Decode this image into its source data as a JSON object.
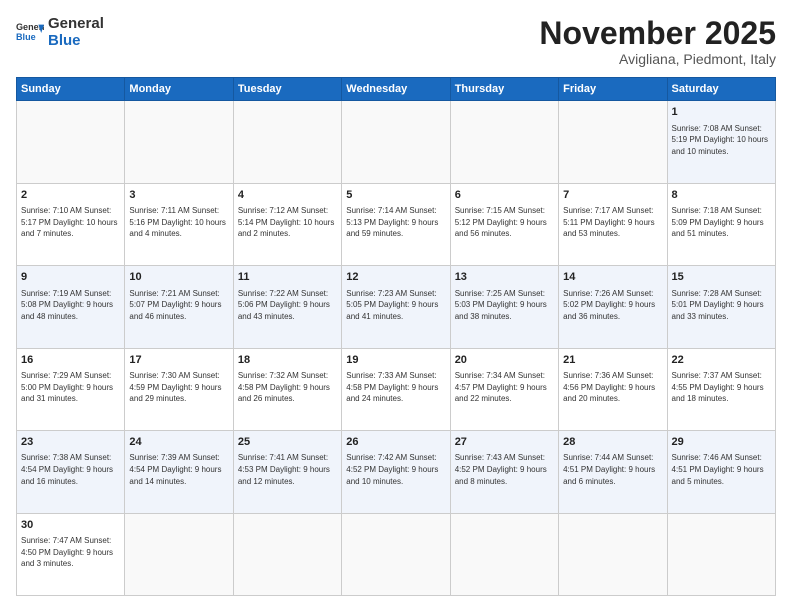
{
  "logo": {
    "text_general": "General",
    "text_blue": "Blue"
  },
  "header": {
    "month_title": "November 2025",
    "subtitle": "Avigliana, Piedmont, Italy"
  },
  "weekdays": [
    "Sunday",
    "Monday",
    "Tuesday",
    "Wednesday",
    "Thursday",
    "Friday",
    "Saturday"
  ],
  "weeks": [
    [
      {
        "day": "",
        "info": ""
      },
      {
        "day": "",
        "info": ""
      },
      {
        "day": "",
        "info": ""
      },
      {
        "day": "",
        "info": ""
      },
      {
        "day": "",
        "info": ""
      },
      {
        "day": "",
        "info": ""
      },
      {
        "day": "1",
        "info": "Sunrise: 7:08 AM\nSunset: 5:19 PM\nDaylight: 10 hours and 10 minutes."
      }
    ],
    [
      {
        "day": "2",
        "info": "Sunrise: 7:10 AM\nSunset: 5:17 PM\nDaylight: 10 hours and 7 minutes."
      },
      {
        "day": "3",
        "info": "Sunrise: 7:11 AM\nSunset: 5:16 PM\nDaylight: 10 hours and 4 minutes."
      },
      {
        "day": "4",
        "info": "Sunrise: 7:12 AM\nSunset: 5:14 PM\nDaylight: 10 hours and 2 minutes."
      },
      {
        "day": "5",
        "info": "Sunrise: 7:14 AM\nSunset: 5:13 PM\nDaylight: 9 hours and 59 minutes."
      },
      {
        "day": "6",
        "info": "Sunrise: 7:15 AM\nSunset: 5:12 PM\nDaylight: 9 hours and 56 minutes."
      },
      {
        "day": "7",
        "info": "Sunrise: 7:17 AM\nSunset: 5:11 PM\nDaylight: 9 hours and 53 minutes."
      },
      {
        "day": "8",
        "info": "Sunrise: 7:18 AM\nSunset: 5:09 PM\nDaylight: 9 hours and 51 minutes."
      }
    ],
    [
      {
        "day": "9",
        "info": "Sunrise: 7:19 AM\nSunset: 5:08 PM\nDaylight: 9 hours and 48 minutes."
      },
      {
        "day": "10",
        "info": "Sunrise: 7:21 AM\nSunset: 5:07 PM\nDaylight: 9 hours and 46 minutes."
      },
      {
        "day": "11",
        "info": "Sunrise: 7:22 AM\nSunset: 5:06 PM\nDaylight: 9 hours and 43 minutes."
      },
      {
        "day": "12",
        "info": "Sunrise: 7:23 AM\nSunset: 5:05 PM\nDaylight: 9 hours and 41 minutes."
      },
      {
        "day": "13",
        "info": "Sunrise: 7:25 AM\nSunset: 5:03 PM\nDaylight: 9 hours and 38 minutes."
      },
      {
        "day": "14",
        "info": "Sunrise: 7:26 AM\nSunset: 5:02 PM\nDaylight: 9 hours and 36 minutes."
      },
      {
        "day": "15",
        "info": "Sunrise: 7:28 AM\nSunset: 5:01 PM\nDaylight: 9 hours and 33 minutes."
      }
    ],
    [
      {
        "day": "16",
        "info": "Sunrise: 7:29 AM\nSunset: 5:00 PM\nDaylight: 9 hours and 31 minutes."
      },
      {
        "day": "17",
        "info": "Sunrise: 7:30 AM\nSunset: 4:59 PM\nDaylight: 9 hours and 29 minutes."
      },
      {
        "day": "18",
        "info": "Sunrise: 7:32 AM\nSunset: 4:58 PM\nDaylight: 9 hours and 26 minutes."
      },
      {
        "day": "19",
        "info": "Sunrise: 7:33 AM\nSunset: 4:58 PM\nDaylight: 9 hours and 24 minutes."
      },
      {
        "day": "20",
        "info": "Sunrise: 7:34 AM\nSunset: 4:57 PM\nDaylight: 9 hours and 22 minutes."
      },
      {
        "day": "21",
        "info": "Sunrise: 7:36 AM\nSunset: 4:56 PM\nDaylight: 9 hours and 20 minutes."
      },
      {
        "day": "22",
        "info": "Sunrise: 7:37 AM\nSunset: 4:55 PM\nDaylight: 9 hours and 18 minutes."
      }
    ],
    [
      {
        "day": "23",
        "info": "Sunrise: 7:38 AM\nSunset: 4:54 PM\nDaylight: 9 hours and 16 minutes."
      },
      {
        "day": "24",
        "info": "Sunrise: 7:39 AM\nSunset: 4:54 PM\nDaylight: 9 hours and 14 minutes."
      },
      {
        "day": "25",
        "info": "Sunrise: 7:41 AM\nSunset: 4:53 PM\nDaylight: 9 hours and 12 minutes."
      },
      {
        "day": "26",
        "info": "Sunrise: 7:42 AM\nSunset: 4:52 PM\nDaylight: 9 hours and 10 minutes."
      },
      {
        "day": "27",
        "info": "Sunrise: 7:43 AM\nSunset: 4:52 PM\nDaylight: 9 hours and 8 minutes."
      },
      {
        "day": "28",
        "info": "Sunrise: 7:44 AM\nSunset: 4:51 PM\nDaylight: 9 hours and 6 minutes."
      },
      {
        "day": "29",
        "info": "Sunrise: 7:46 AM\nSunset: 4:51 PM\nDaylight: 9 hours and 5 minutes."
      }
    ],
    [
      {
        "day": "30",
        "info": "Sunrise: 7:47 AM\nSunset: 4:50 PM\nDaylight: 9 hours and 3 minutes."
      },
      {
        "day": "",
        "info": ""
      },
      {
        "day": "",
        "info": ""
      },
      {
        "day": "",
        "info": ""
      },
      {
        "day": "",
        "info": ""
      },
      {
        "day": "",
        "info": ""
      },
      {
        "day": "",
        "info": ""
      }
    ]
  ]
}
